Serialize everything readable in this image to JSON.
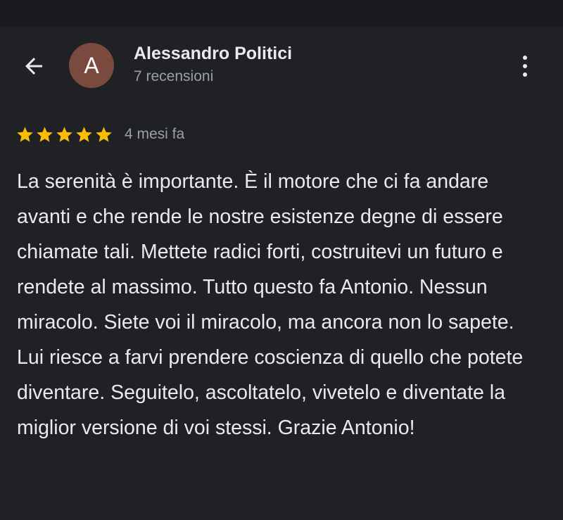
{
  "colors": {
    "background": "#202124",
    "text_primary": "#e8eaed",
    "text_secondary": "#9aa0a6",
    "star": "#fbbc04",
    "avatar_background": "#7a4a3e"
  },
  "header": {
    "back_icon": "arrow-left-icon",
    "avatar_initial": "A",
    "author_name": "Alessandro Politici",
    "review_count": "7 recensioni",
    "more_icon": "more-vertical-icon"
  },
  "review": {
    "rating": 5,
    "max_rating": 5,
    "date": "4 mesi fa",
    "text": "La serenità è importante. È il motore che ci fa andare avanti e che rende le nostre esistenze degne di essere chiamate tali. Mettete radici forti, costruitevi un futuro e rendete al massimo. Tutto questo fa Antonio. Nessun miracolo. Siete voi il miracolo, ma ancora non lo sapete. Lui riesce a farvi prendere coscienza di quello che potete diventare. Seguitelo, ascoltatelo, vivetelo e diventate la miglior versione di voi stessi. Grazie Antonio!"
  }
}
